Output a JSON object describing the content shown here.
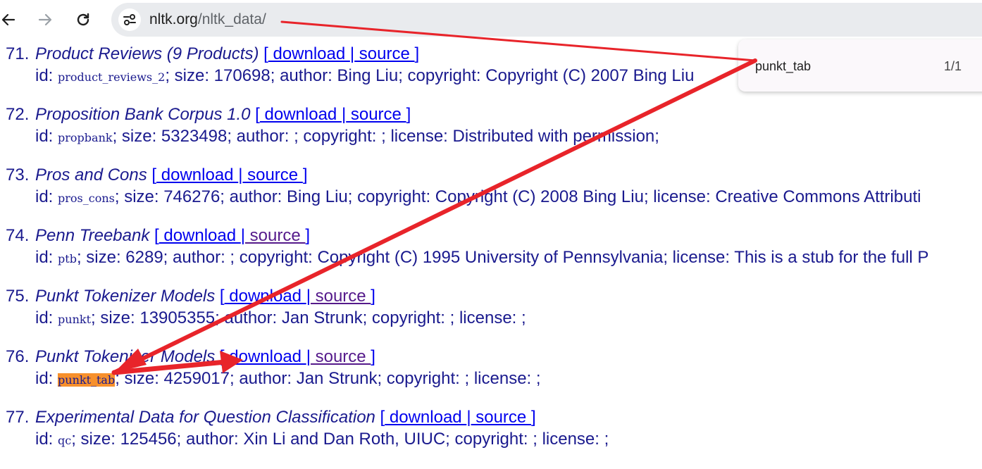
{
  "browser": {
    "url_host": "nltk.org",
    "url_path": "/nltk_data/"
  },
  "findbar": {
    "query": "punkt_tab",
    "count": "1/1"
  },
  "entries": [
    {
      "num": "71.",
      "title": "Product Reviews (9 Products)",
      "bracket_open": " [",
      "download": " download ",
      "sep": "|",
      "source": " source ",
      "bracket_close": "]",
      "id_label": "id: ",
      "id": "product_reviews_2",
      "rest": "; size: 170698; author: Bing Liu; copyright: Copyright (C) 2007 Bing Liu"
    },
    {
      "num": "72.",
      "title": "Proposition Bank Corpus 1.0",
      "bracket_open": " [",
      "download": " download ",
      "sep": "|",
      "source": " source ",
      "bracket_close": "]",
      "id_label": "id: ",
      "id": "propbank",
      "rest": "; size: 5323498; author: ; copyright: ; license: Distributed with permission;"
    },
    {
      "num": "73.",
      "title": "Pros and Cons",
      "bracket_open": " [",
      "download": " download ",
      "sep": "|",
      "source": " source ",
      "bracket_close": "]",
      "id_label": "id: ",
      "id": "pros_cons",
      "rest": "; size: 746276; author: Bing Liu; copyright: Copyright (C) 2008 Bing Liu; license: Creative Commons Attributi"
    },
    {
      "num": "74.",
      "title": "Penn Treebank",
      "bracket_open": " [",
      "download": " download ",
      "sep": "|",
      "source": " source ",
      "bracket_close": "]",
      "id_label": "id: ",
      "id": "ptb",
      "rest": "; size: 6289; author: ; copyright: Copyright (C) 1995 University of Pennsylvania; license: This is a stub for the full P"
    },
    {
      "num": "75.",
      "title": "Punkt Tokenizer Models",
      "bracket_open": " [",
      "download": " download ",
      "sep": "|",
      "source": " source ",
      "bracket_close": "]",
      "id_label": "id: ",
      "id": "punkt",
      "rest": "; size: 13905355; author: Jan Strunk; copyright: ; license: ;"
    },
    {
      "num": "76.",
      "title": "Punkt Tokenizer Models",
      "bracket_open": " [",
      "download": " download ",
      "sep": "|",
      "source": " source ",
      "bracket_close": "]",
      "id_label": "id: ",
      "id": "punkt_tab",
      "rest": "; size: 4259017; author: Jan Strunk; copyright: ; license: ;"
    },
    {
      "num": "77.",
      "title": "Experimental Data for Question Classification",
      "bracket_open": " [",
      "download": " download ",
      "sep": "|",
      "source": " source ",
      "bracket_close": "]",
      "id_label": "id: ",
      "id": "qc",
      "rest": "; size: 125456; author: Xin Li and Dan Roth, UIUC; copyright: ; license: ;"
    }
  ],
  "colors": {
    "text": "#1a1a8e",
    "link": "#0000ee",
    "visited": "#551a8b",
    "highlight": "#f7902c",
    "annotation": "#e8242a"
  },
  "icons": [
    "back-arrow-icon",
    "forward-arrow-icon",
    "reload-icon",
    "site-info-icon"
  ]
}
